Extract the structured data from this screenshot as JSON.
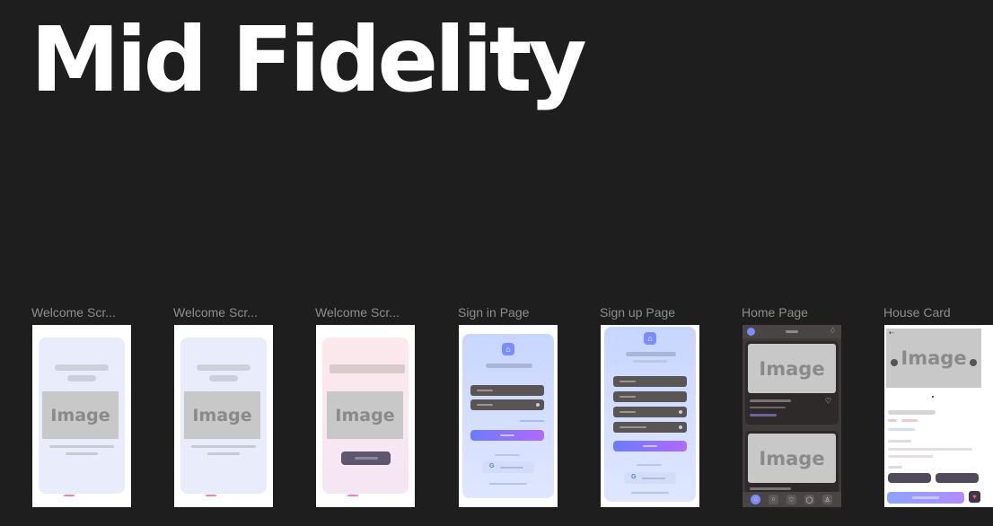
{
  "heading": "Mid Fidelity",
  "frames": [
    {
      "label": "Welcome Scr...",
      "image_text": "Image"
    },
    {
      "label": "Welcome Scr...",
      "image_text": "Image"
    },
    {
      "label": "Welcome Scr...",
      "image_text": "Image"
    },
    {
      "label": "Sign in Page"
    },
    {
      "label": "Sign up Page"
    },
    {
      "label": "Home Page",
      "image_text": "Image"
    },
    {
      "label": "House Card",
      "image_text": "Image"
    }
  ],
  "icons": {
    "logo": "house-icon",
    "eye": "eye-icon",
    "google": "google-icon",
    "bell": "bell-icon",
    "heart": "heart-icon",
    "back": "back-arrow-icon",
    "nav": [
      "home-icon",
      "search-icon",
      "heart-icon",
      "chat-icon",
      "profile-icon"
    ]
  },
  "colors": {
    "canvas": "#1e1e1e",
    "heading": "#ffffff",
    "label": "#8d8d8d",
    "accent_gradient_start": "#6a7cff",
    "accent_gradient_end": "#b06aff",
    "placeholder": "#c8c8c8"
  }
}
